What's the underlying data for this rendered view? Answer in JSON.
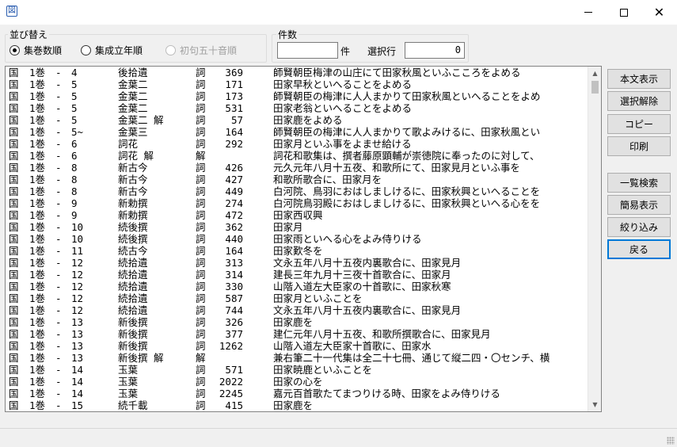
{
  "window": {
    "app_icon": "book-icon",
    "controls": [
      "minimize-icon",
      "maximize-icon",
      "close-icon"
    ]
  },
  "sort": {
    "title": "並び替え",
    "options": [
      {
        "label": "集巻数順",
        "checked": true,
        "disabled": false
      },
      {
        "label": "集成立年順",
        "checked": false,
        "disabled": false
      },
      {
        "label": "初句五十音順",
        "checked": false,
        "disabled": true
      }
    ]
  },
  "count": {
    "title": "件数",
    "value": "",
    "unit": "件",
    "selected_label": "選択行",
    "selected_value": "0"
  },
  "buttons": {
    "honbun": "本文表示",
    "deselect": "選択解除",
    "copy": "コピー",
    "print": "印刷",
    "list_search": "一覧検索",
    "simple_view": "簡易表示",
    "narrow": "絞り込み",
    "back": "戻る"
  },
  "rows": [
    {
      "kind": "国",
      "vol": "1巻",
      "num": "4",
      "book": "後拾遺",
      "tag": "詞",
      "no": "369",
      "note": "師賢朝臣梅津の山庄にて田家秋風といふこころをよめる"
    },
    {
      "kind": "国",
      "vol": "1巻",
      "num": "5",
      "book": "金葉二",
      "tag": "詞",
      "no": "171",
      "note": "田家早秋といへることをよめる"
    },
    {
      "kind": "国",
      "vol": "1巻",
      "num": "5",
      "book": "金葉二",
      "tag": "詞",
      "no": "173",
      "note": "師賢朝臣の梅津に人人まかりて田家秋風といへることをよめ"
    },
    {
      "kind": "国",
      "vol": "1巻",
      "num": "5",
      "book": "金葉二",
      "tag": "詞",
      "no": "531",
      "note": "田家老翁といへることをよめる"
    },
    {
      "kind": "国",
      "vol": "1巻",
      "num": "5",
      "book": "金葉二 解",
      "tag": "詞",
      "no": "57",
      "note": "田家鹿をよめる"
    },
    {
      "kind": "国",
      "vol": "1巻",
      "num": "5~",
      "book": "金葉三",
      "tag": "詞",
      "no": "164",
      "note": "師賢朝臣の梅津に人人まかりて歌よみけるに、田家秋風とい"
    },
    {
      "kind": "国",
      "vol": "1巻",
      "num": "6",
      "book": "詞花",
      "tag": "詞",
      "no": "292",
      "note": "田家月といふ事をよませ給ける"
    },
    {
      "kind": "国",
      "vol": "1巻",
      "num": "6",
      "book": "詞花 解",
      "tag": "解",
      "no": "",
      "note": "詞花和歌集は、撰者藤原顕輔が崇徳院に奉ったのに対して、"
    },
    {
      "kind": "国",
      "vol": "1巻",
      "num": "8",
      "book": "新古今",
      "tag": "詞",
      "no": "426",
      "note": "元久元年八月十五夜、和歌所にて、田家見月といふ事を"
    },
    {
      "kind": "国",
      "vol": "1巻",
      "num": "8",
      "book": "新古今",
      "tag": "詞",
      "no": "427",
      "note": "和歌所歌合に、田家月を"
    },
    {
      "kind": "国",
      "vol": "1巻",
      "num": "8",
      "book": "新古今",
      "tag": "詞",
      "no": "449",
      "note": "白河院、鳥羽におはしましけるに、田家秋興といへることを"
    },
    {
      "kind": "国",
      "vol": "1巻",
      "num": "9",
      "book": "新勅撰",
      "tag": "詞",
      "no": "274",
      "note": "白河院鳥羽殿におはしましけるに、田家秋興といへる心をを"
    },
    {
      "kind": "国",
      "vol": "1巻",
      "num": "9",
      "book": "新勅撰",
      "tag": "詞",
      "no": "472",
      "note": "田家西収興"
    },
    {
      "kind": "国",
      "vol": "1巻",
      "num": "10",
      "book": "続後撰",
      "tag": "詞",
      "no": "362",
      "note": "田家月"
    },
    {
      "kind": "国",
      "vol": "1巻",
      "num": "10",
      "book": "続後撰",
      "tag": "詞",
      "no": "440",
      "note": "田家雨といへる心をよみ侍りける"
    },
    {
      "kind": "国",
      "vol": "1巻",
      "num": "11",
      "book": "続古今",
      "tag": "詞",
      "no": "164",
      "note": "田家歎冬を"
    },
    {
      "kind": "国",
      "vol": "1巻",
      "num": "12",
      "book": "続拾遺",
      "tag": "詞",
      "no": "313",
      "note": "文永五年八月十五夜内裏歌合に、田家見月"
    },
    {
      "kind": "国",
      "vol": "1巻",
      "num": "12",
      "book": "続拾遺",
      "tag": "詞",
      "no": "314",
      "note": "建長三年九月十三夜十首歌合に、田家月"
    },
    {
      "kind": "国",
      "vol": "1巻",
      "num": "12",
      "book": "続拾遺",
      "tag": "詞",
      "no": "330",
      "note": "山階入道左大臣家の十首歌に、田家秋寒"
    },
    {
      "kind": "国",
      "vol": "1巻",
      "num": "12",
      "book": "続拾遺",
      "tag": "詞",
      "no": "587",
      "note": "田家月といふことを"
    },
    {
      "kind": "国",
      "vol": "1巻",
      "num": "12",
      "book": "続拾遺",
      "tag": "詞",
      "no": "744",
      "note": "文永五年八月十五夜内裏歌合に、田家見月"
    },
    {
      "kind": "国",
      "vol": "1巻",
      "num": "13",
      "book": "新後撰",
      "tag": "詞",
      "no": "326",
      "note": "田家鹿を"
    },
    {
      "kind": "国",
      "vol": "1巻",
      "num": "13",
      "book": "新後撰",
      "tag": "詞",
      "no": "377",
      "note": "建仁元年八月十五夜、和歌所撰歌合に、田家見月"
    },
    {
      "kind": "国",
      "vol": "1巻",
      "num": "13",
      "book": "新後撰",
      "tag": "詞",
      "no": "1262",
      "note": "山階入道左大臣家十首歌に、田家水"
    },
    {
      "kind": "国",
      "vol": "1巻",
      "num": "13",
      "book": "新後撰 解",
      "tag": "解",
      "no": "",
      "note": "兼右筆二十一代集は全二十七冊、通じて縦二四・〇センチ、横"
    },
    {
      "kind": "国",
      "vol": "1巻",
      "num": "14",
      "book": "玉葉",
      "tag": "詞",
      "no": "571",
      "note": "田家暁鹿といふことを"
    },
    {
      "kind": "国",
      "vol": "1巻",
      "num": "14",
      "book": "玉葉",
      "tag": "詞",
      "no": "2022",
      "note": "田家の心を"
    },
    {
      "kind": "国",
      "vol": "1巻",
      "num": "14",
      "book": "玉葉",
      "tag": "詞",
      "no": "2245",
      "note": "嘉元百首歌たてまつりける時、田家をよみ侍りける"
    },
    {
      "kind": "国",
      "vol": "1巻",
      "num": "15",
      "book": "続千載",
      "tag": "詞",
      "no": "415",
      "note": "田家鹿を"
    }
  ]
}
